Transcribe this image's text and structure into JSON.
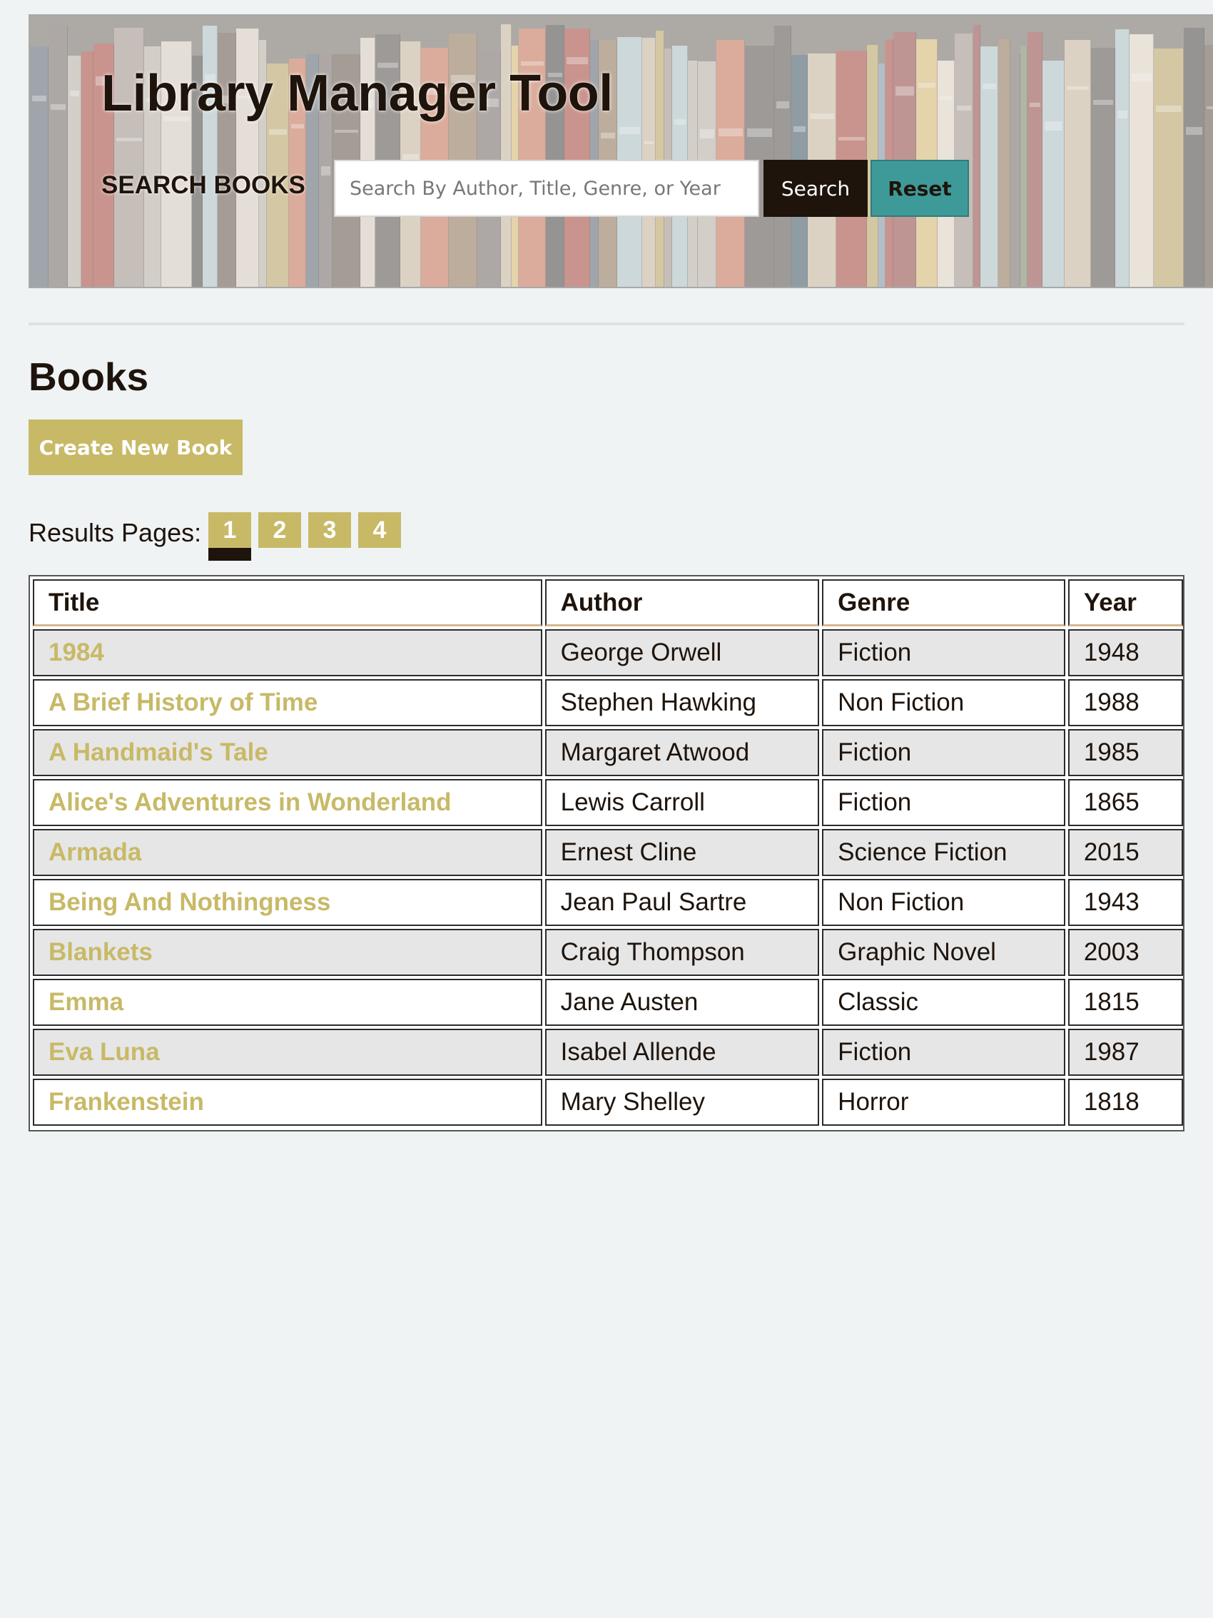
{
  "header": {
    "title": "Library Manager Tool",
    "search_label": "SEARCH BOOKS",
    "search_placeholder": "Search By Author, Title, Genre, or Year",
    "search_value": "",
    "search_button": "Search",
    "reset_button": "Reset"
  },
  "main": {
    "heading": "Books",
    "create_button": "Create New Book",
    "pager": {
      "label": "Results Pages:",
      "pages": [
        "1",
        "2",
        "3",
        "4"
      ],
      "current": "1"
    },
    "table": {
      "columns": [
        "Title",
        "Author",
        "Genre",
        "Year"
      ],
      "rows": [
        {
          "title": "1984",
          "author": "George Orwell",
          "genre": "Fiction",
          "year": "1948"
        },
        {
          "title": "A Brief History of Time",
          "author": "Stephen Hawking",
          "genre": "Non Fiction",
          "year": "1988"
        },
        {
          "title": "A Handmaid's Tale",
          "author": "Margaret Atwood",
          "genre": "Fiction",
          "year": "1985"
        },
        {
          "title": "Alice's Adventures in Wonderland",
          "author": "Lewis Carroll",
          "genre": "Fiction",
          "year": "1865"
        },
        {
          "title": "Armada",
          "author": "Ernest Cline",
          "genre": "Science Fiction",
          "year": "2015"
        },
        {
          "title": "Being And Nothingness",
          "author": "Jean Paul Sartre",
          "genre": "Non Fiction",
          "year": "1943"
        },
        {
          "title": "Blankets",
          "author": "Craig Thompson",
          "genre": "Graphic Novel",
          "year": "2003"
        },
        {
          "title": "Emma",
          "author": "Jane Austen",
          "genre": "Classic",
          "year": "1815"
        },
        {
          "title": "Eva Luna",
          "author": "Isabel Allende",
          "genre": "Fiction",
          "year": "1987"
        },
        {
          "title": "Frankenstein",
          "author": "Mary Shelley",
          "genre": "Horror",
          "year": "1818"
        }
      ]
    }
  },
  "colors": {
    "accent_gold": "#c8b967",
    "dark_brown": "#1e140c",
    "teal": "#3e9a99",
    "background": "#f0f3f4",
    "row_alt": "#e6e6e6"
  },
  "icons": {
    "banner_image": "bookshelf-banner-image"
  }
}
